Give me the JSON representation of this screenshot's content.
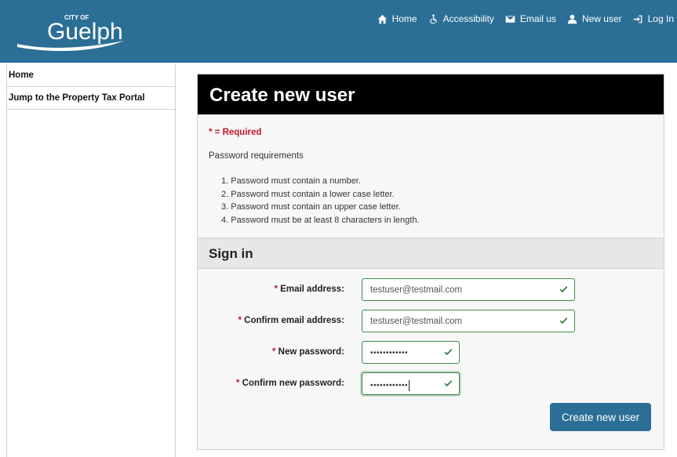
{
  "header": {
    "logo_small": "CITY OF",
    "logo_text": "Guelph",
    "nav": [
      {
        "label": "Home",
        "icon": "home-icon"
      },
      {
        "label": "Accessibility",
        "icon": "accessibility-icon"
      },
      {
        "label": "Email us",
        "icon": "email-icon"
      },
      {
        "label": "New user",
        "icon": "user-icon"
      },
      {
        "label": "Log In",
        "icon": "login-icon"
      }
    ],
    "color": "#2b6f97"
  },
  "sidebar": {
    "items": [
      {
        "label": "Home"
      },
      {
        "label": "Jump to the Property Tax Portal"
      }
    ]
  },
  "panel": {
    "title": "Create new user",
    "required_note": "* = Required",
    "pw_heading": "Password requirements",
    "requirements": [
      "1. Password must contain a number.",
      "2. Password must contain a lower case letter.",
      "3. Password must contain an upper case letter.",
      "4. Password must be at least 8 characters in length."
    ],
    "section_title": "Sign in",
    "fields": [
      {
        "label": "Email address:",
        "value": "testuser@testmail.com"
      },
      {
        "label": "Confirm email address:",
        "value": "testuser@testmail.com"
      },
      {
        "label": "New password:",
        "value": "••••••••••••"
      },
      {
        "label": "Confirm new password:",
        "value": "••••••••••••"
      }
    ],
    "required_star": "* ",
    "submit_label": "Create new user"
  },
  "colors": {
    "accent": "#2b6f97",
    "required": "#c0182c",
    "valid": "#2e7d3c"
  }
}
